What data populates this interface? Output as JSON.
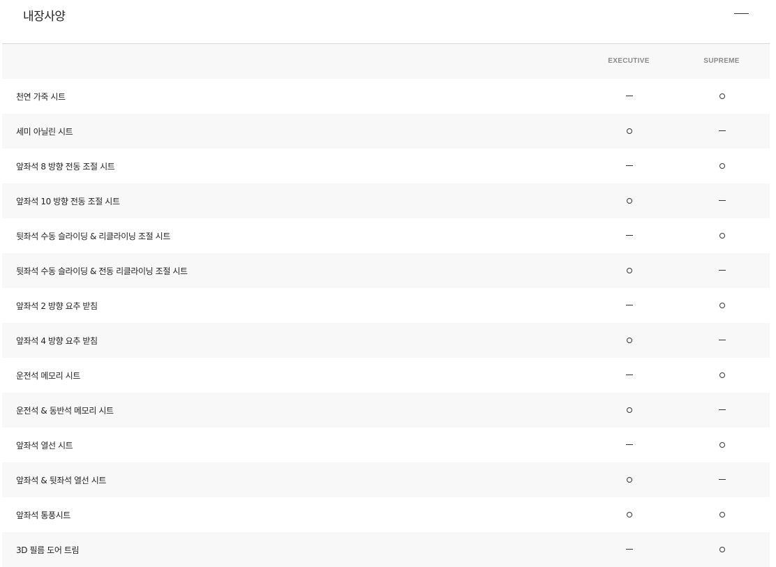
{
  "section": {
    "title": "내장사양",
    "toggle_icon": "minus-icon"
  },
  "columns": [
    "EXECUTIVE",
    "SUPREME"
  ],
  "legend": {
    "available": "circle",
    "not_available": "dash"
  },
  "rows": [
    {
      "label": "천연 가죽 시트",
      "executive": "dash",
      "supreme": "circle"
    },
    {
      "label": "세미 아닐린 시트",
      "executive": "circle",
      "supreme": "dash"
    },
    {
      "label": "앞좌석 8 방향 전동 조절 시트",
      "executive": "dash",
      "supreme": "circle"
    },
    {
      "label": "앞좌석 10 방향 전동 조절 시트",
      "executive": "circle",
      "supreme": "dash"
    },
    {
      "label": "뒷좌석 수동 슬라이딩 & 리클라이닝 조절 시트",
      "executive": "dash",
      "supreme": "circle"
    },
    {
      "label": "뒷좌석 수동 슬라이딩 & 전동 리클라이닝 조절 시트",
      "executive": "circle",
      "supreme": "dash"
    },
    {
      "label": "앞좌석 2 방향 요추 받침",
      "executive": "dash",
      "supreme": "circle"
    },
    {
      "label": "앞좌석 4 방향 요추 받침",
      "executive": "circle",
      "supreme": "dash"
    },
    {
      "label": "운전석 메모리 시트",
      "executive": "dash",
      "supreme": "circle"
    },
    {
      "label": "운전석 & 동반석 메모리 시트",
      "executive": "circle",
      "supreme": "dash"
    },
    {
      "label": "앞좌석 열선 시트",
      "executive": "dash",
      "supreme": "circle"
    },
    {
      "label": "앞좌석 & 뒷좌석 열선 시트",
      "executive": "circle",
      "supreme": "dash"
    },
    {
      "label": "앞좌석 통풍시트",
      "executive": "circle",
      "supreme": "circle"
    },
    {
      "label": "3D 필름 도어 트림",
      "executive": "dash",
      "supreme": "circle"
    }
  ]
}
